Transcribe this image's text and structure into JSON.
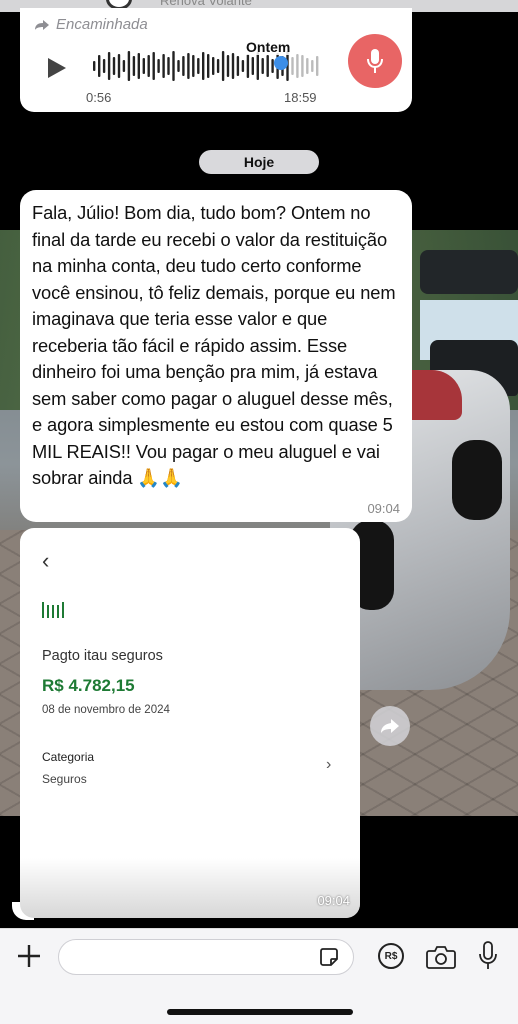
{
  "header": {
    "title": "Renova Volante"
  },
  "audio_message": {
    "forwarded_label": "Encaminhada",
    "day_label": "Ontem",
    "duration": "0:56",
    "time": "18:59"
  },
  "date_separator": "Hoje",
  "text_message": {
    "body": "Fala, Júlio! Bom dia, tudo bom? Ontem no final da tarde eu recebi o valor da restituição na minha conta, deu tudo certo conforme você ensinou, tô feliz demais, porque eu nem imaginava que teria esse valor e que receberia tão fácil e rápido assim. Esse dinheiro foi uma benção pra mim, já estava sem saber como pagar o aluguel desse mês, e agora simplesmente eu estou com quase 5 MIL REAIS!! Vou pagar o meu aluguel e vai sobrar ainda 🙏🙏",
    "time": "09:04"
  },
  "receipt": {
    "title": "Pagto itau seguros",
    "amount": "R$ 4.782,15",
    "date": "08 de novembro de 2024",
    "category_label": "Categoria",
    "category_value": "Seguros",
    "time": "09:04"
  },
  "composer": {
    "placeholder": "",
    "pix_label": "R$"
  },
  "colors": {
    "amount_green": "#1e7a34",
    "mic_badge": "#e86565",
    "audio_progress": "#3c8ee8"
  },
  "icons": [
    "forward-arrow-icon",
    "play-icon",
    "microphone-icon",
    "back-chevron-icon",
    "bank-logo-icon",
    "chevron-right-icon",
    "share-forward-icon",
    "plus-icon",
    "sticker-icon",
    "pix-icon",
    "camera-icon",
    "mic-icon"
  ]
}
